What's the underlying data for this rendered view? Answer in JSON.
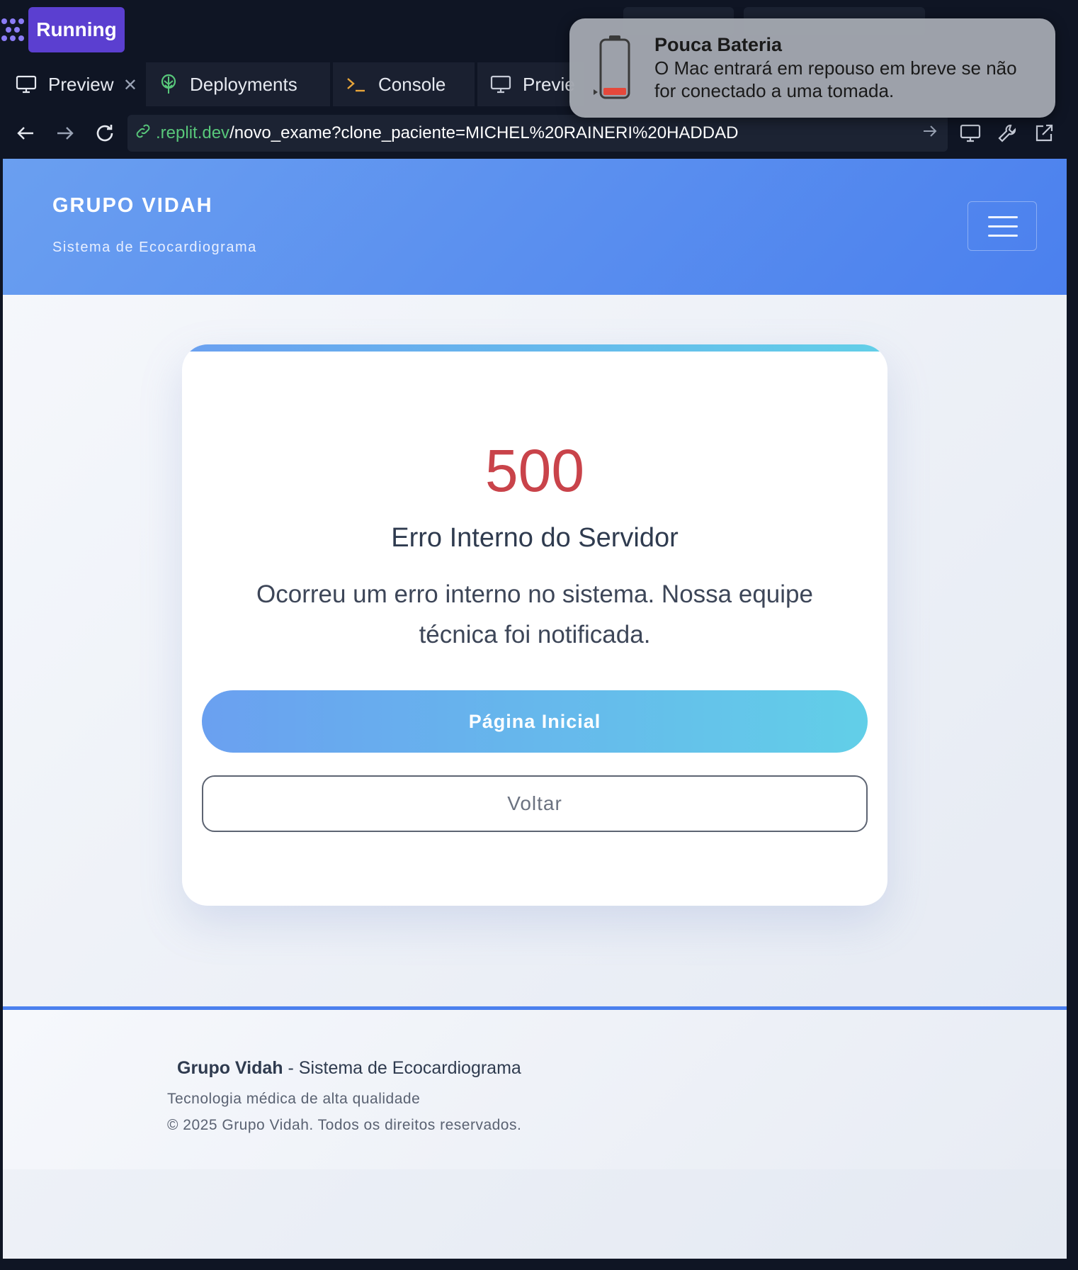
{
  "topbar": {
    "status_label": "Running"
  },
  "tabs": [
    {
      "label": "Preview",
      "icon": "monitor-icon",
      "active": true
    },
    {
      "label": "Deployments",
      "icon": "deploy-icon",
      "active": false
    },
    {
      "label": "Console",
      "icon": "terminal-icon",
      "active": false
    },
    {
      "label": "Previe",
      "icon": "monitor-icon",
      "active": false
    }
  ],
  "urlbar": {
    "host": ".replit.dev",
    "path": "/novo_exame?clone_paciente=MICHEL%20RAINERI%20HADDAD"
  },
  "notification": {
    "title": "Pouca Bateria",
    "body": "O Mac entrará em repouso em breve se não for conectado a uma tomada."
  },
  "site_header": {
    "brand": "GRUPO VIDAH",
    "subtitle": "Sistema de Ecocardiograma"
  },
  "error_card": {
    "code": "500",
    "title": "Erro Interno do Servidor",
    "message": "Ocorreu um erro interno no sistema. Nossa equipe técnica foi notificada.",
    "primary_button": "Página Inicial",
    "secondary_button": "Voltar"
  },
  "footer": {
    "brand": "Grupo Vidah",
    "tagline": " - Sistema de Ecocardiograma",
    "line2": "Tecnologia médica de alta qualidade",
    "line3": "© 2025 Grupo Vidah. Todos os direitos reservados."
  },
  "colors": {
    "accent": "#4b80ee",
    "error": "#c9434a",
    "running": "#5b3fd0",
    "link_host": "#58c77a"
  }
}
